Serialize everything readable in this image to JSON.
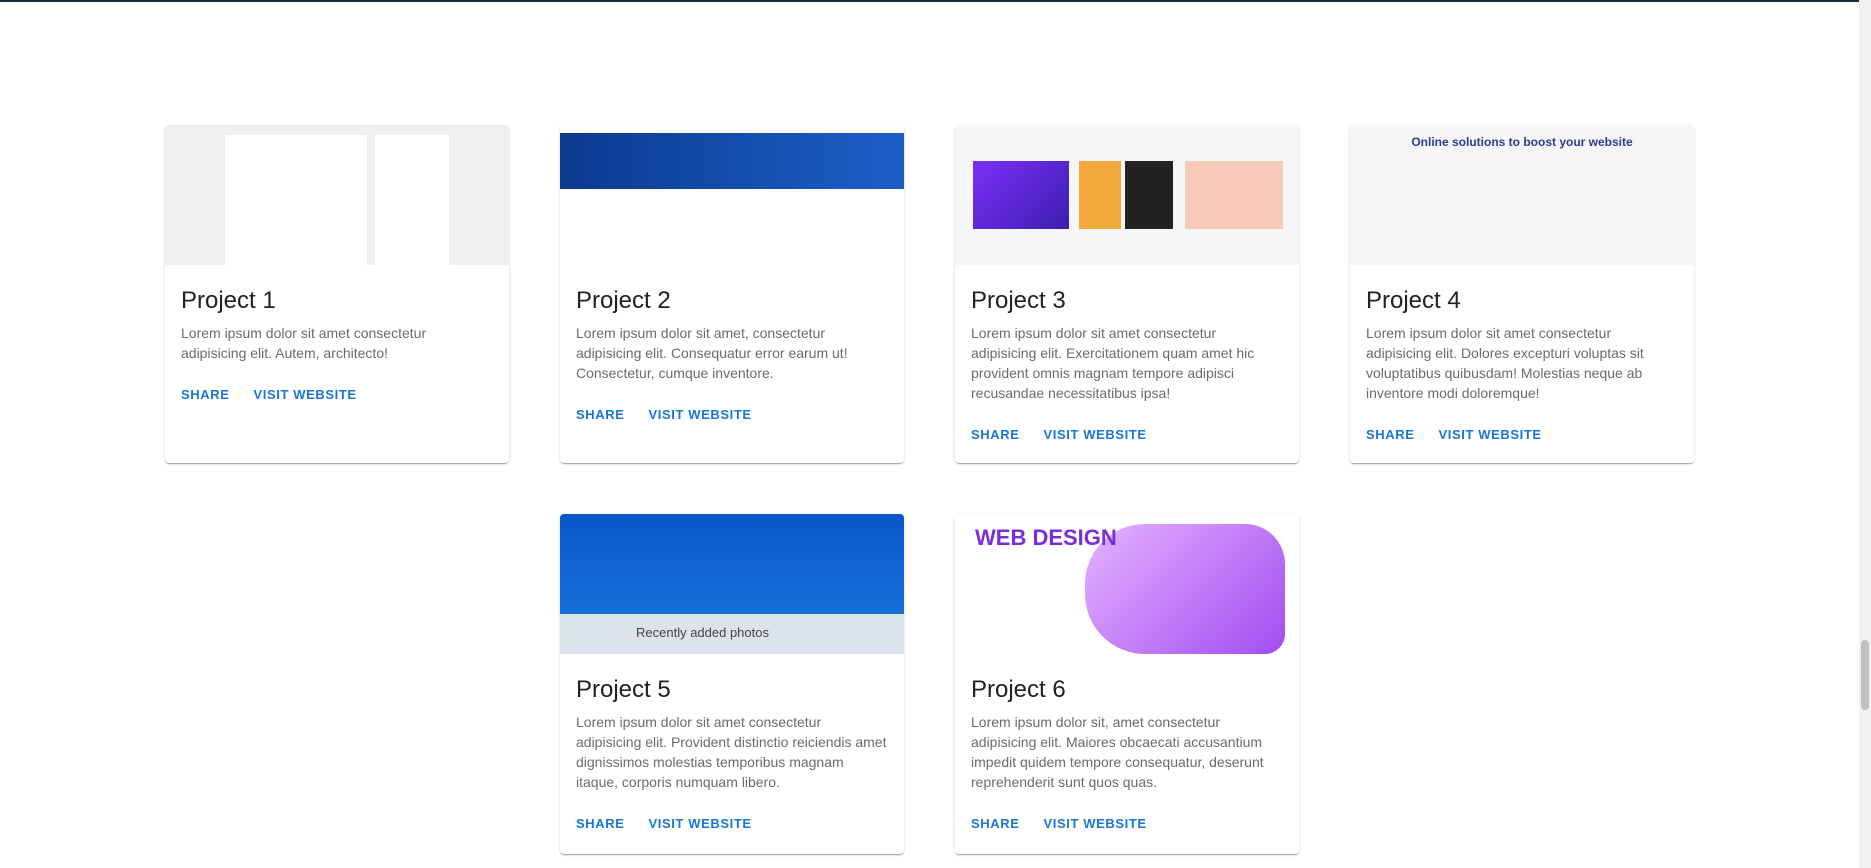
{
  "projects": [
    {
      "title": "Project 1",
      "description": "Lorem ipsum dolor sit amet consectetur adipisicing elit. Autem, architecto!",
      "share": "SHARE",
      "visit": "VISIT WEBSITE"
    },
    {
      "title": "Project 2",
      "description": "Lorem ipsum dolor sit amet, consectetur adipisicing elit. Consequatur error earum ut! Consectetur, cumque inventore.",
      "share": "SHARE",
      "visit": "VISIT WEBSITE"
    },
    {
      "title": "Project 3",
      "description": "Lorem ipsum dolor sit amet consectetur adipisicing elit. Exercitationem quam amet hic provident omnis magnam tempore adipisci recusandae necessitatibus ipsa!",
      "share": "SHARE",
      "visit": "VISIT WEBSITE"
    },
    {
      "title": "Project 4",
      "description": "Lorem ipsum dolor sit amet consectetur adipisicing elit. Dolores excepturi voluptas sit voluptatibus quibusdam! Molestias neque ab inventore modi doloremque!",
      "share": "SHARE",
      "visit": "VISIT WEBSITE",
      "thumb_text": "Online solutions to boost your website"
    },
    {
      "title": "Project 5",
      "description": "Lorem ipsum dolor sit amet consectetur adipisicing elit. Provident distinctio reiciendis amet dignissimos molestias temporibus magnam itaque, corporis numquam libero.",
      "share": "SHARE",
      "visit": "VISIT WEBSITE",
      "thumb_text": "Recently added photos"
    },
    {
      "title": "Project 6",
      "description": "Lorem ipsum dolor sit, amet consectetur adipisicing elit. Maiores obcaecati accusantium impedit quidem tempore consequatur, deserunt reprehenderit sunt quos quas.",
      "share": "SHARE",
      "visit": "VISIT WEBSITE",
      "thumb_text": "WEB DESIGN"
    }
  ],
  "colors": {
    "accent": "#1976d2",
    "title": "#212121",
    "text": "#6b6b6b"
  }
}
